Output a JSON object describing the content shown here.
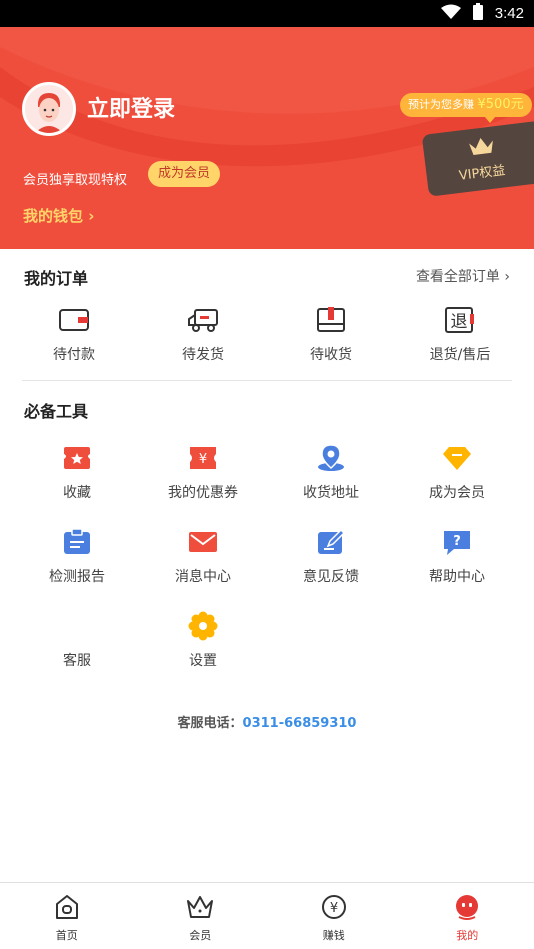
{
  "status_bar": {
    "time": "3:42"
  },
  "header": {
    "login_title": "立即登录",
    "vip_desc": "会员独享取现特权",
    "join_button": "成为会员",
    "wallet_link": "我的钱包 ›",
    "earn_bubble": {
      "text": "预计为您多赚",
      "amount": "¥500元"
    },
    "vip_card_label": "VIP权益"
  },
  "orders": {
    "title": "我的订单",
    "view_all": "查看全部订单 ›",
    "items": [
      {
        "label": "待付款",
        "icon": "wallet-icon"
      },
      {
        "label": "待发货",
        "icon": "truck-icon"
      },
      {
        "label": "待收货",
        "icon": "package-icon"
      },
      {
        "label": "退货/售后",
        "icon": "return-icon"
      }
    ]
  },
  "tools": {
    "title": "必备工具",
    "items": [
      {
        "label": "收藏",
        "icon": "favorite-icon",
        "color": "#f04e3d"
      },
      {
        "label": "我的优惠券",
        "icon": "coupon-icon",
        "color": "#f04e3d"
      },
      {
        "label": "收货地址",
        "icon": "location-icon",
        "color": "#4a7fe0"
      },
      {
        "label": "成为会员",
        "icon": "diamond-icon",
        "color": "#ffb400"
      },
      {
        "label": "检测报告",
        "icon": "report-icon",
        "color": "#4a7fe0"
      },
      {
        "label": "消息中心",
        "icon": "mail-icon",
        "color": "#f04e3d"
      },
      {
        "label": "意见反馈",
        "icon": "feedback-icon",
        "color": "#4a7fe0"
      },
      {
        "label": "帮助中心",
        "icon": "help-icon",
        "color": "#4a7fe0"
      },
      {
        "label": "客服",
        "icon": "customer-service-icon",
        "color": "#ffb400"
      },
      {
        "label": "设置",
        "icon": "settings-icon",
        "color": "#ffb400"
      }
    ]
  },
  "service_phone": {
    "label": "客服电话：",
    "number": "0311-66859310"
  },
  "bottom_nav": {
    "items": [
      {
        "label": "首页",
        "icon": "home-icon"
      },
      {
        "label": "会员",
        "icon": "crown-icon"
      },
      {
        "label": "赚钱",
        "icon": "yuan-icon"
      },
      {
        "label": "我的",
        "icon": "profile-icon",
        "active": true
      }
    ]
  },
  "colors": {
    "brand_red": "#f04e3d",
    "accent_yellow": "#ffd56a",
    "link_blue": "#3a8ee6"
  }
}
